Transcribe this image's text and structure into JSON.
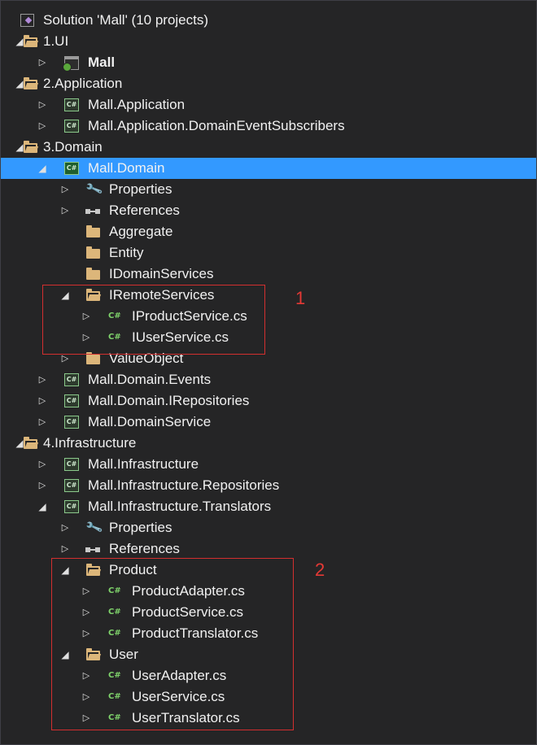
{
  "colors": {
    "background": "#252526",
    "selection": "#3399ff",
    "folder": "#dcb67a",
    "csharp": "#7fd36b",
    "annotation": "#e53935"
  },
  "tree": [
    {
      "label": "Solution 'Mall' (10 projects)",
      "icon": "solution-icon",
      "depth": 0,
      "expander": "none"
    },
    {
      "label": "1.UI",
      "icon": "folder-open-icon",
      "depth": 0,
      "expander": "open"
    },
    {
      "label": "Mall",
      "icon": "web-project-icon",
      "depth": 1,
      "expander": "closed",
      "bold": true
    },
    {
      "label": "2.Application",
      "icon": "folder-open-icon",
      "depth": 0,
      "expander": "open"
    },
    {
      "label": "Mall.Application",
      "icon": "csharp-project-icon",
      "depth": 1,
      "expander": "closed"
    },
    {
      "label": "Mall.Application.DomainEventSubscribers",
      "icon": "csharp-project-icon",
      "depth": 1,
      "expander": "closed"
    },
    {
      "label": "3.Domain",
      "icon": "folder-open-icon",
      "depth": 0,
      "expander": "open"
    },
    {
      "label": "Mall.Domain",
      "icon": "csharp-project-icon",
      "depth": 1,
      "expander": "open",
      "selected": true
    },
    {
      "label": "Properties",
      "icon": "wrench-icon",
      "depth": 2,
      "expander": "closed"
    },
    {
      "label": "References",
      "icon": "references-icon",
      "depth": 2,
      "expander": "closed"
    },
    {
      "label": "Aggregate",
      "icon": "folder-icon",
      "depth": 2,
      "expander": "none"
    },
    {
      "label": "Entity",
      "icon": "folder-icon",
      "depth": 2,
      "expander": "none"
    },
    {
      "label": "IDomainServices",
      "icon": "folder-icon",
      "depth": 2,
      "expander": "none"
    },
    {
      "label": "IRemoteServices",
      "icon": "folder-open-icon",
      "depth": 2,
      "expander": "open"
    },
    {
      "label": "IProductService.cs",
      "icon": "csharp-file-icon",
      "depth": 3,
      "expander": "closed"
    },
    {
      "label": "IUserService.cs",
      "icon": "csharp-file-icon",
      "depth": 3,
      "expander": "closed"
    },
    {
      "label": "ValueObject",
      "icon": "folder-icon",
      "depth": 2,
      "expander": "closed"
    },
    {
      "label": "Mall.Domain.Events",
      "icon": "csharp-project-icon",
      "depth": 1,
      "expander": "closed"
    },
    {
      "label": "Mall.Domain.IRepositories",
      "icon": "csharp-project-icon",
      "depth": 1,
      "expander": "closed"
    },
    {
      "label": "Mall.DomainService",
      "icon": "csharp-project-icon",
      "depth": 1,
      "expander": "closed"
    },
    {
      "label": "4.Infrastructure",
      "icon": "folder-open-icon",
      "depth": 0,
      "expander": "open"
    },
    {
      "label": "Mall.Infrastructure",
      "icon": "csharp-project-icon",
      "depth": 1,
      "expander": "closed"
    },
    {
      "label": "Mall.Infrastructure.Repositories",
      "icon": "csharp-project-icon",
      "depth": 1,
      "expander": "closed"
    },
    {
      "label": "Mall.Infrastructure.Translators",
      "icon": "csharp-project-icon",
      "depth": 1,
      "expander": "open"
    },
    {
      "label": "Properties",
      "icon": "wrench-icon",
      "depth": 2,
      "expander": "closed"
    },
    {
      "label": "References",
      "icon": "references-icon",
      "depth": 2,
      "expander": "closed"
    },
    {
      "label": "Product",
      "icon": "folder-open-icon",
      "depth": 2,
      "expander": "open"
    },
    {
      "label": "ProductAdapter.cs",
      "icon": "csharp-file-icon",
      "depth": 3,
      "expander": "closed"
    },
    {
      "label": "ProductService.cs",
      "icon": "csharp-file-icon",
      "depth": 3,
      "expander": "closed"
    },
    {
      "label": "ProductTranslator.cs",
      "icon": "csharp-file-icon",
      "depth": 3,
      "expander": "closed"
    },
    {
      "label": "User",
      "icon": "folder-open-icon",
      "depth": 2,
      "expander": "open"
    },
    {
      "label": "UserAdapter.cs",
      "icon": "csharp-file-icon",
      "depth": 3,
      "expander": "closed"
    },
    {
      "label": "UserService.cs",
      "icon": "csharp-file-icon",
      "depth": 3,
      "expander": "closed"
    },
    {
      "label": "UserTranslator.cs",
      "icon": "csharp-file-icon",
      "depth": 3,
      "expander": "closed"
    }
  ],
  "annotations": [
    {
      "label": "1"
    },
    {
      "label": "2"
    }
  ]
}
